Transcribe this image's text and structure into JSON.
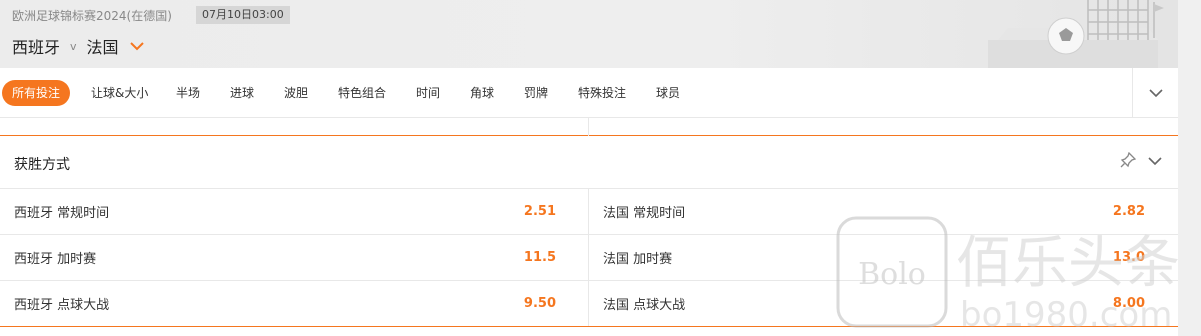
{
  "header": {
    "league": "欧洲足球锦标赛2024(在德国)",
    "datetime": "07月10日03:00",
    "home_team": "西班牙",
    "vs": "v",
    "away_team": "法国"
  },
  "tabs": [
    {
      "label": "所有投注",
      "active": true
    },
    {
      "label": "让球&大小"
    },
    {
      "label": "半场"
    },
    {
      "label": "进球"
    },
    {
      "label": "波胆"
    },
    {
      "label": "特色组合"
    },
    {
      "label": "时间"
    },
    {
      "label": "角球"
    },
    {
      "label": "罚牌"
    },
    {
      "label": "特殊投注"
    },
    {
      "label": "球员"
    }
  ],
  "section": {
    "title": "获胜方式",
    "rows": [
      {
        "left": {
          "name": "西班牙 常规时间",
          "odds": "2.51"
        },
        "right": {
          "name": "法国 常规时间",
          "odds": "2.82"
        }
      },
      {
        "left": {
          "name": "西班牙 加时赛",
          "odds": "11.5"
        },
        "right": {
          "name": "法国 加时赛",
          "odds": "13.0"
        }
      },
      {
        "left": {
          "name": "西班牙 点球大战",
          "odds": "9.50"
        },
        "right": {
          "name": "法国 点球大战",
          "odds": "8.00"
        }
      }
    ]
  },
  "watermark": {
    "text": "佰乐头条",
    "logo": "Bolo",
    "url": "bo1980.com"
  },
  "colors": {
    "accent": "#f5761f",
    "odds": "#f5761f"
  }
}
